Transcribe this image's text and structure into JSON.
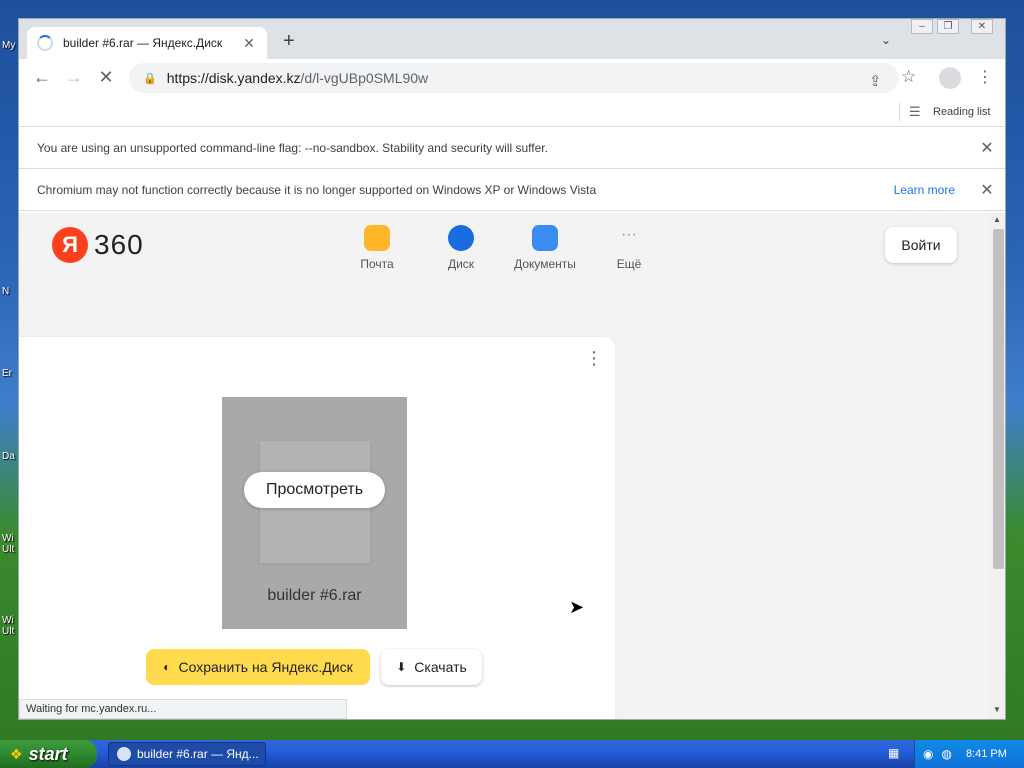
{
  "desktop": {
    "labels": [
      "My",
      "N",
      "Er",
      "Da",
      "Wi\nUlt",
      "Wi\nUlt"
    ]
  },
  "browser": {
    "tab_title": "builder #6.rar — Яндекс.Диск",
    "tab_close": "✕",
    "new_tab": "+",
    "tab_search": "⌄",
    "url_host": "https://disk.yandex.kz",
    "url_path": "/d/l-vgUBp0SML90w",
    "reading_list": "Reading list",
    "infobar1": "You are using an unsupported command-line flag: --no-sandbox. Stability and security will suffer.",
    "infobar2": "Chromium may not function correctly because it is no longer supported on Windows XP or Windows Vista",
    "learn_more": "Learn more",
    "status_text": "Waiting for mc.yandex.ru..."
  },
  "page": {
    "logo_letter": "Я",
    "logo_text": "360",
    "services": [
      {
        "label": "Почта",
        "color": "#ffb629"
      },
      {
        "label": "Диск",
        "color": "#1a6ce0"
      },
      {
        "label": "Документы",
        "color": "#3a8cf0"
      },
      {
        "label": "Ещё",
        "color": "#f3f3f3"
      }
    ],
    "login": "Войти",
    "view_button": "Просмотреть",
    "file_name": "builder #6.rar",
    "save_button": "Сохранить на Яндекс.Диск",
    "download_button": "Скачать"
  },
  "taskbar": {
    "start": "start",
    "task_title": "builder #6.rar — Янд...",
    "clock": "8:41 PM"
  },
  "colors": {
    "accent_yellow": "#ffdb4d",
    "yandex_red": "#fc3f1d",
    "link_blue": "#1a73e8"
  }
}
